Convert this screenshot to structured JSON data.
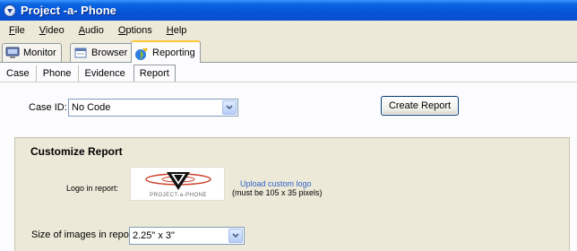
{
  "window": {
    "title": "Project -a- Phone"
  },
  "menu": [
    {
      "mnemonic": "F",
      "rest": "ile"
    },
    {
      "mnemonic": "V",
      "rest": "ideo"
    },
    {
      "mnemonic": "A",
      "rest": "udio"
    },
    {
      "mnemonic": "O",
      "rest": "ptions"
    },
    {
      "mnemonic": "H",
      "rest": "elp"
    }
  ],
  "top_tabs": [
    {
      "label": "Monitor",
      "icon": "monitor-icon"
    },
    {
      "label": "Browser",
      "icon": "folder-icon"
    },
    {
      "label": "Reporting",
      "icon": "report-icon",
      "active": true
    }
  ],
  "sub_tabs": [
    "Case",
    "Phone",
    "Evidence",
    "Report"
  ],
  "case": {
    "label": "Case ID:",
    "value": "No Code"
  },
  "create_report_label": "Create Report",
  "customize": {
    "title": "Customize Report",
    "logo_label": "Logo in report:",
    "logo_text": "PROJECT-a-PHONE",
    "upload_link": "Upload custom logo",
    "logo_note": "(must be 105 x 35 pixels)",
    "size_label": "Size of images in report:",
    "size_value": "2.25\" x 3\""
  },
  "colors": {
    "titlebar": "#0554d6",
    "tab_accent": "#ffc83c",
    "link": "#2d63c8",
    "panel": "#ece9d8"
  }
}
